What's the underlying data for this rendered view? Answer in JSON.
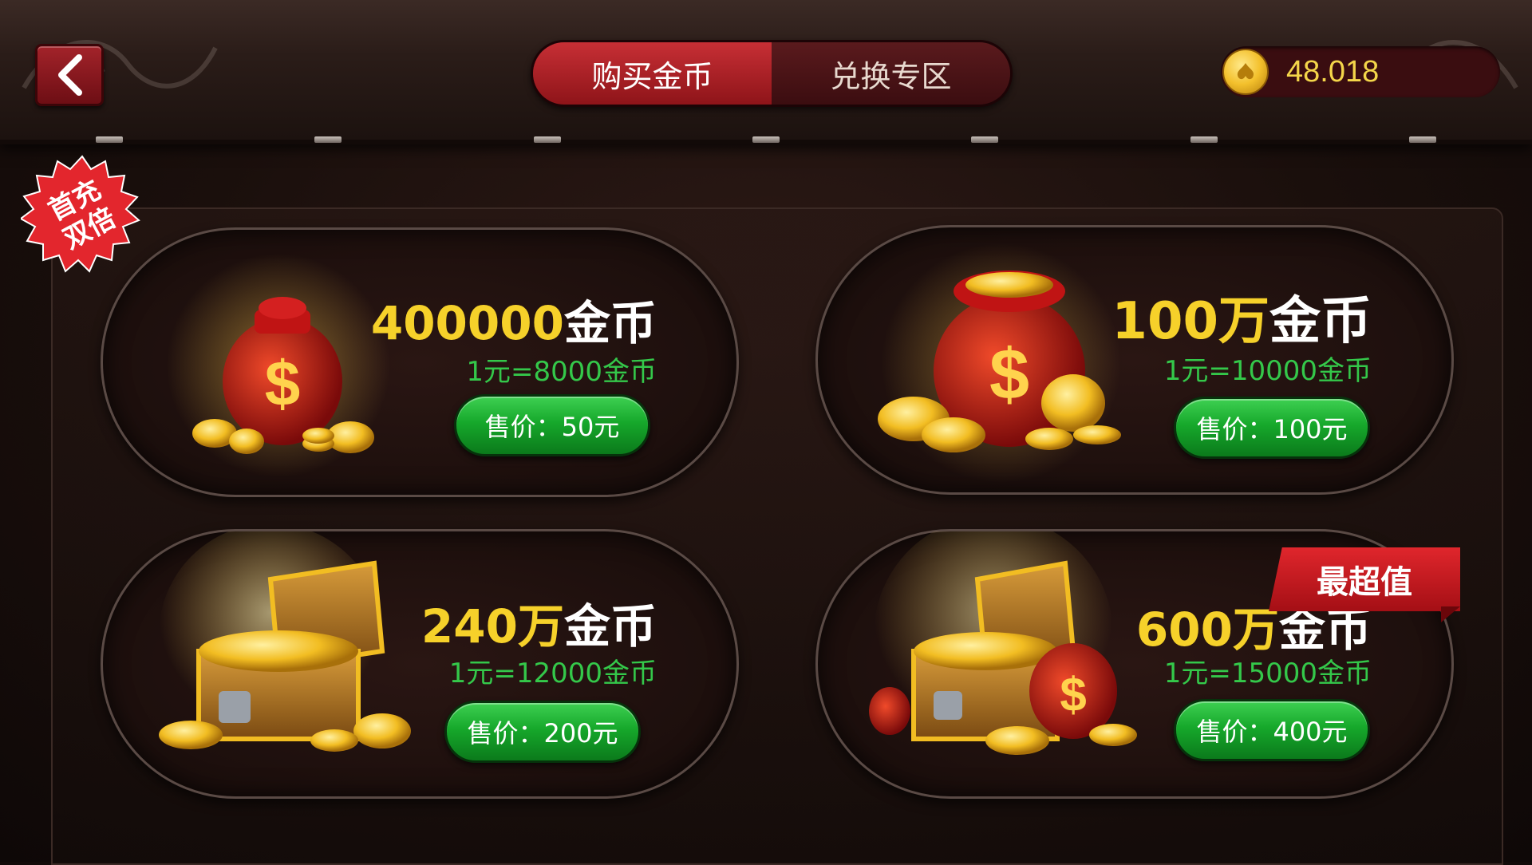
{
  "header": {
    "tabs": [
      {
        "label": "购买金币",
        "active": true
      },
      {
        "label": "兑换专区",
        "active": false
      }
    ],
    "balance": "48.018"
  },
  "badge": {
    "line1": "首充",
    "line2": "双倍"
  },
  "packages": [
    {
      "title_num": "400000",
      "title_unit": "金币",
      "rate": "1元=8000金币",
      "price": "售价：50元",
      "art": "gold-bag-icon"
    },
    {
      "title_num": "100万",
      "title_unit": "金币",
      "rate": "1元=10000金币",
      "price": "售价：100元",
      "art": "large-gold-bag-icon"
    },
    {
      "title_num": "240万",
      "title_unit": "金币",
      "rate": "1元=12000金币",
      "price": "售价：200元",
      "art": "treasure-chest-icon"
    },
    {
      "title_num": "600万",
      "title_unit": "金币",
      "rate": "1元=15000金币",
      "price": "售价：400元",
      "art": "treasure-chest-with-bags-icon"
    }
  ],
  "ribbon": "最超值",
  "colors": {
    "gold": "#f6d12a",
    "rate_green": "#34c84a",
    "button_green": "#16a82b",
    "tab_red": "#c72f35"
  }
}
